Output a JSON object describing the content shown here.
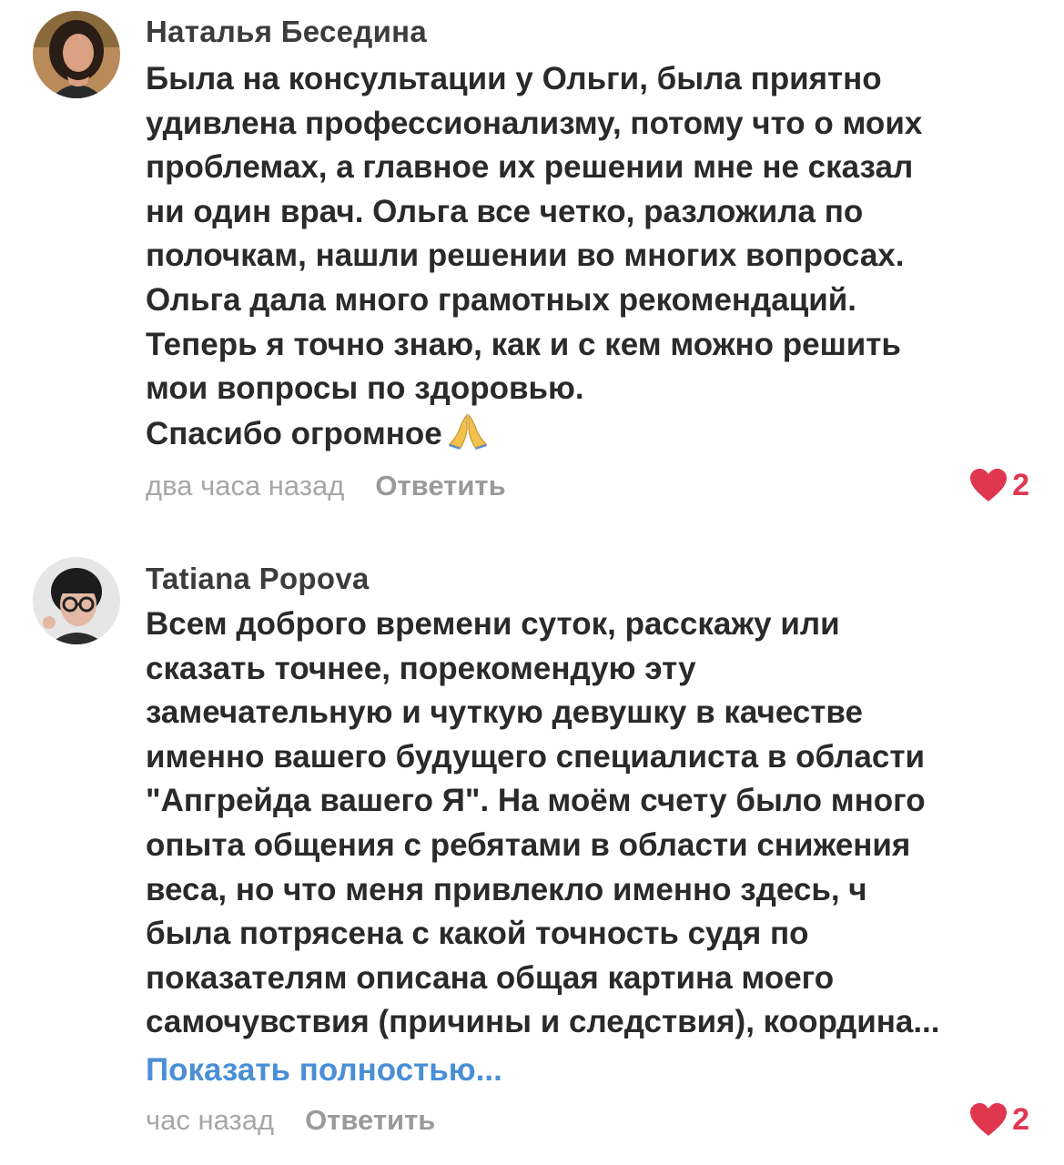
{
  "comments": [
    {
      "author": "Наталья Беседина",
      "lines": [
        "Была на консультации у Ольги, была приятно",
        "удивлена профессионализму, потому что о моих",
        "проблемах, а главное их решении мне не сказал",
        "ни один врач. Ольга все четко, разложила по",
        "полочкам, нашли решении во многих вопросах.",
        "Ольга дала много грамотных рекомендаций.",
        "Теперь я точно знаю, как и с кем можно решить",
        "мои вопросы по здоровью.",
        "Спасибо огромное"
      ],
      "emoji": "folded-hands-icon",
      "time": "два часа назад",
      "reply_label": "Ответить",
      "likes": "2"
    },
    {
      "author": "Tatiana Popova",
      "lines": [
        "Всем доброго времени суток, расскажу или",
        "сказать точнее, порекомендую эту",
        "замечательную и чуткую девушку в качестве",
        "именно вашего будущего специалиста в области",
        "\"Апгрейда вашего Я\". На моём счету было много",
        "опыта общения с ребятами в области снижения",
        "веса, но что меня привлекло именно здесь, ч",
        "была потрясена с какой точность судя по",
        "показателям описана общая картина моего",
        "самочувствия (причины и следствия), координа..."
      ],
      "show_more": "Показать полностью...",
      "time": "час назад",
      "reply_label": "Ответить",
      "likes": "2"
    }
  ],
  "colors": {
    "text": "#2a2a2a",
    "meta": "#a7a7a7",
    "link": "#4a8fd6",
    "like": "#e0374f"
  }
}
